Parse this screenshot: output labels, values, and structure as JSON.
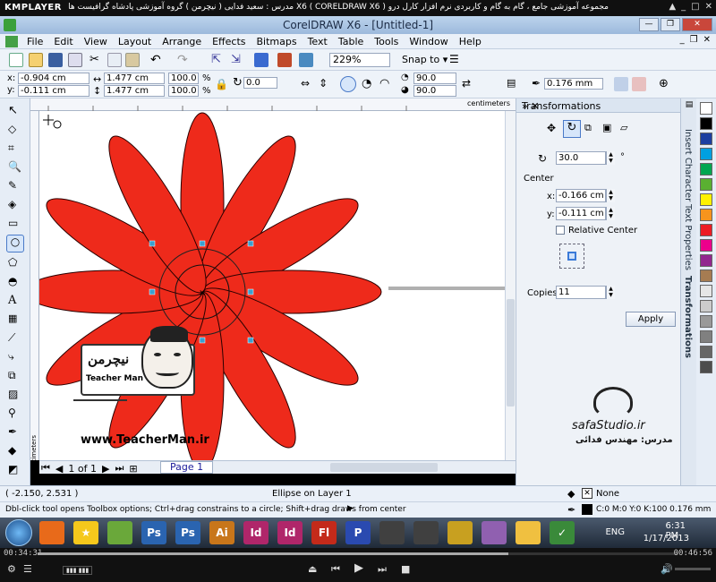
{
  "player": {
    "logo": "KMPLAYER",
    "caption": "مجموعه آموزشی جامع ، گام به گام و کاربردی نرم افزار کارل درو X6 ( CORELDRAW X6 ) مدرس : سعید فدایی ( نیچرمن ) گروه آموزشی پادشاه گرافیست ها",
    "time_elapsed": "00:34:31",
    "time_total": "00:46:56",
    "progress": 0.735
  },
  "window": {
    "title": "CorelDRAW X6 - [Untitled-1]"
  },
  "menu": [
    "File",
    "Edit",
    "View",
    "Layout",
    "Arrange",
    "Effects",
    "Bitmaps",
    "Text",
    "Table",
    "Tools",
    "Window",
    "Help"
  ],
  "toolbar": {
    "zoom": "229%",
    "snap_to": "Snap to"
  },
  "propbar": {
    "x_label": "x:",
    "x_value": "-0.904 cm",
    "y_label": "y:",
    "y_value": "-0.111 cm",
    "width": "1.477 cm",
    "height": "1.477 cm",
    "scale_w": "100.0",
    "scale_h": "100.0",
    "percent": "%",
    "rotation": "0.0",
    "start_angle": "90.0",
    "end_angle": "90.0",
    "outline_width": "0.176 mm"
  },
  "rulers": {
    "unit": "centimeters"
  },
  "canvas": {
    "watermark_url": "www.TeacherMan.ir",
    "logo_text": "Teacher Man",
    "studio_name": "safaStudio.ir",
    "instructor_line": "مدرس: مهندس فدائی",
    "petal_color": "#ee2a1b"
  },
  "pager": {
    "page_of": "1 of 1",
    "page_tab": "Page 1"
  },
  "docker": {
    "title": "Transformations",
    "angle": "30.0",
    "degree_symbol": "°",
    "center_label": "Center",
    "center_x_label": "x:",
    "center_x": "-0.166 cm",
    "center_y_label": "y:",
    "center_y": "-0.111 cm",
    "relative_center_label": "Relative Center",
    "copies_label": "Copies:",
    "copies": "11",
    "apply_label": "Apply"
  },
  "sidetabs": [
    "Insert Character",
    "Text Properties",
    "Transformations"
  ],
  "palette": [
    "#ffffff",
    "#000000",
    "#1c3fa0",
    "#00a0e0",
    "#00a651",
    "#5ab031",
    "#fff200",
    "#f7941d",
    "#ed1c24",
    "#ec008c",
    "#92278f",
    "#a67c52",
    "#e6e6e6",
    "#cccccc",
    "#999999",
    "#808080",
    "#666666",
    "#4d4d4d"
  ],
  "status": {
    "coords": "( -2.150, 2.531 )",
    "object_info": "Ellipse on Layer 1",
    "fill_label": "None",
    "hint": "Dbl-click tool opens Toolbox options; Ctrl+drag constrains to a circle; Shift+drag draws from center",
    "outline_info": "C:0 M:0 Y:0 K:100  0.176 mm"
  },
  "taskbar": {
    "lang": "ENG",
    "time": "6:31 PM",
    "date": "1/17/2013",
    "apps": [
      "Firefox",
      "Corel",
      "Photoshop",
      "Photoshop",
      "Illustrator",
      "InDesign",
      "InDesign",
      "Flash",
      "Lightroom",
      "Cinema4D",
      "Cinema4D",
      "Corel",
      "Disc",
      "Explorer",
      "Dreamweaver",
      "CorelDRAW"
    ]
  }
}
